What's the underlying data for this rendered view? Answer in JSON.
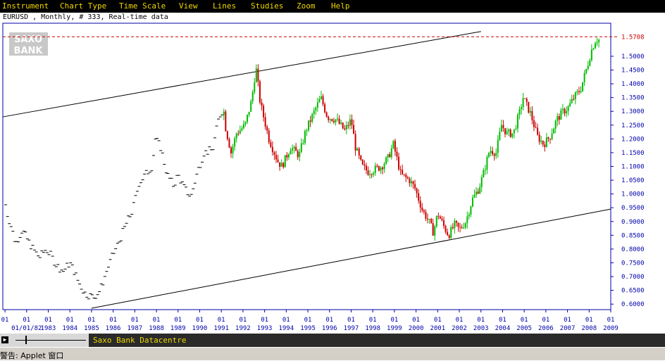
{
  "menu": {
    "items": [
      "Instrument",
      "Chart Type",
      "Time Scale",
      "View",
      "Lines",
      "Studies",
      "Zoom",
      "Help"
    ]
  },
  "info": {
    "text": "EURUSD , Monthly, # 333, Real-time data"
  },
  "logo": {
    "line1": "SAXO",
    "line2": "BANK"
  },
  "footer": {
    "title": "Saxo Bank Datacentre"
  },
  "status": {
    "text": "警告: Applet 窗口"
  },
  "colors": {
    "up": "#00bb00",
    "down": "#cc0000",
    "neutral": "#000000",
    "axis": "#0000aa",
    "last_price": "#cc0000",
    "menu_text": "#f0d800"
  },
  "chart_data": {
    "type": "candlestick",
    "instrument": "EURUSD",
    "timeframe": "Monthly",
    "last_price": 1.5708,
    "last_price_label": "1.5708",
    "ylim": [
      0.58,
      1.62
    ],
    "xlim": [
      1980.9,
      2009.0
    ],
    "y_ticks": [
      "1.5000",
      "1.4500",
      "1.4000",
      "1.3500",
      "1.3000",
      "1.2500",
      "1.2000",
      "1.1500",
      "1.1000",
      "1.0500",
      "1.0000",
      "0.9500",
      "0.9000",
      "0.8500",
      "0.8000",
      "0.7500",
      "0.7000",
      "0.6500",
      "0.6000"
    ],
    "x_ticks": [
      {
        "t": 1981.0,
        "top": "01",
        "bottom": ""
      },
      {
        "t": 1982.0,
        "top": "01",
        "bottom": "01/01/82"
      },
      {
        "t": 1983.0,
        "top": "01",
        "bottom": "1983"
      },
      {
        "t": 1984.0,
        "top": "01",
        "bottom": "1984"
      },
      {
        "t": 1985.0,
        "top": "01",
        "bottom": "1985"
      },
      {
        "t": 1986.0,
        "top": "01",
        "bottom": "1986"
      },
      {
        "t": 1987.0,
        "top": "01",
        "bottom": "1987"
      },
      {
        "t": 1988.0,
        "top": "01",
        "bottom": "1988"
      },
      {
        "t": 1989.0,
        "top": "01",
        "bottom": "1989"
      },
      {
        "t": 1990.0,
        "top": "01",
        "bottom": "1990"
      },
      {
        "t": 1991.0,
        "top": "01",
        "bottom": "1991"
      },
      {
        "t": 1992.0,
        "top": "01",
        "bottom": "1992"
      },
      {
        "t": 1993.0,
        "top": "01",
        "bottom": "1993"
      },
      {
        "t": 1994.0,
        "top": "01",
        "bottom": "1994"
      },
      {
        "t": 1995.0,
        "top": "01",
        "bottom": "1995"
      },
      {
        "t": 1996.0,
        "top": "01",
        "bottom": "1996"
      },
      {
        "t": 1997.0,
        "top": "01",
        "bottom": "1997"
      },
      {
        "t": 1998.0,
        "top": "01",
        "bottom": "1998"
      },
      {
        "t": 1999.0,
        "top": "01",
        "bottom": "1999"
      },
      {
        "t": 2000.0,
        "top": "01",
        "bottom": "2000"
      },
      {
        "t": 2001.0,
        "top": "01",
        "bottom": "2001"
      },
      {
        "t": 2002.0,
        "top": "01",
        "bottom": "2002"
      },
      {
        "t": 2003.0,
        "top": "01",
        "bottom": "2003"
      },
      {
        "t": 2004.0,
        "top": "01",
        "bottom": "2004"
      },
      {
        "t": 2005.0,
        "top": "01",
        "bottom": "2005"
      },
      {
        "t": 2006.0,
        "top": "01",
        "bottom": "2006"
      },
      {
        "t": 2007.0,
        "top": "01",
        "bottom": "2007"
      },
      {
        "t": 2008.0,
        "top": "01",
        "bottom": "2008"
      },
      {
        "t": 2009.0,
        "top": "01",
        "bottom": "2009"
      }
    ],
    "trendlines": [
      {
        "name": "upper-channel",
        "t1": 1980.9,
        "v1": 1.28,
        "t2": 2003.0,
        "v2": 1.59
      },
      {
        "name": "lower-channel",
        "t1": 1985.0,
        "v1": 0.585,
        "t2": 2009.0,
        "v2": 0.945
      }
    ],
    "anchors": [
      [
        1980.95,
        1.0
      ],
      [
        1981.1,
        0.93
      ],
      [
        1981.3,
        0.88
      ],
      [
        1981.5,
        0.82
      ],
      [
        1981.8,
        0.87
      ],
      [
        1982.0,
        0.84
      ],
      [
        1982.3,
        0.8
      ],
      [
        1982.6,
        0.77
      ],
      [
        1982.9,
        0.8
      ],
      [
        1983.1,
        0.78
      ],
      [
        1983.4,
        0.74
      ],
      [
        1983.7,
        0.72
      ],
      [
        1984.0,
        0.75
      ],
      [
        1984.2,
        0.72
      ],
      [
        1984.4,
        0.68
      ],
      [
        1984.7,
        0.64
      ],
      [
        1985.1,
        0.625
      ],
      [
        1985.4,
        0.65
      ],
      [
        1985.7,
        0.72
      ],
      [
        1986.0,
        0.78
      ],
      [
        1986.3,
        0.83
      ],
      [
        1986.6,
        0.89
      ],
      [
        1986.9,
        0.94
      ],
      [
        1987.2,
        1.04
      ],
      [
        1987.5,
        1.07
      ],
      [
        1987.8,
        1.1
      ],
      [
        1987.95,
        1.2
      ],
      [
        1988.2,
        1.17
      ],
      [
        1988.5,
        1.07
      ],
      [
        1988.8,
        1.03
      ],
      [
        1989.0,
        1.07
      ],
      [
        1989.3,
        1.02
      ],
      [
        1989.6,
        0.99
      ],
      [
        1989.9,
        1.08
      ],
      [
        1990.2,
        1.15
      ],
      [
        1990.6,
        1.16
      ],
      [
        1990.9,
        1.28
      ],
      [
        1991.1,
        1.31
      ],
      [
        1991.2,
        1.24
      ],
      [
        1991.45,
        1.15
      ],
      [
        1991.7,
        1.22
      ],
      [
        1992.1,
        1.25
      ],
      [
        1992.4,
        1.34
      ],
      [
        1992.6,
        1.46
      ],
      [
        1992.8,
        1.33
      ],
      [
        1993.2,
        1.2
      ],
      [
        1993.6,
        1.12
      ],
      [
        1993.8,
        1.1
      ],
      [
        1994.2,
        1.17
      ],
      [
        1994.6,
        1.14
      ],
      [
        1994.9,
        1.23
      ],
      [
        1995.3,
        1.3
      ],
      [
        1995.6,
        1.35
      ],
      [
        1995.9,
        1.28
      ],
      [
        1996.3,
        1.27
      ],
      [
        1996.7,
        1.23
      ],
      [
        1997.0,
        1.27
      ],
      [
        1997.2,
        1.17
      ],
      [
        1997.5,
        1.1
      ],
      [
        1997.8,
        1.08
      ],
      [
        1998.1,
        1.09
      ],
      [
        1998.4,
        1.1
      ],
      [
        1998.7,
        1.13
      ],
      [
        1998.95,
        1.18
      ],
      [
        1999.3,
        1.07
      ],
      [
        1999.7,
        1.05
      ],
      [
        1999.95,
        1.02
      ],
      [
        2000.3,
        0.94
      ],
      [
        2000.6,
        0.9
      ],
      [
        2000.8,
        0.86
      ],
      [
        2001.0,
        0.93
      ],
      [
        2001.3,
        0.88
      ],
      [
        2001.5,
        0.85
      ],
      [
        2001.8,
        0.89
      ],
      [
        2002.0,
        0.87
      ],
      [
        2002.3,
        0.9
      ],
      [
        2002.6,
        0.98
      ],
      [
        2002.9,
        1.02
      ],
      [
        2003.1,
        1.07
      ],
      [
        2003.4,
        1.16
      ],
      [
        2003.7,
        1.15
      ],
      [
        2003.95,
        1.25
      ],
      [
        2004.2,
        1.22
      ],
      [
        2004.5,
        1.22
      ],
      [
        2004.8,
        1.3
      ],
      [
        2004.95,
        1.35
      ],
      [
        2005.3,
        1.29
      ],
      [
        2005.6,
        1.21
      ],
      [
        2005.9,
        1.18
      ],
      [
        2006.2,
        1.21
      ],
      [
        2006.5,
        1.27
      ],
      [
        2006.8,
        1.3
      ],
      [
        2007.0,
        1.31
      ],
      [
        2007.3,
        1.35
      ],
      [
        2007.6,
        1.38
      ],
      [
        2007.9,
        1.46
      ],
      [
        2008.1,
        1.52
      ],
      [
        2008.3,
        1.56
      ],
      [
        2008.5,
        1.56
      ]
    ]
  }
}
